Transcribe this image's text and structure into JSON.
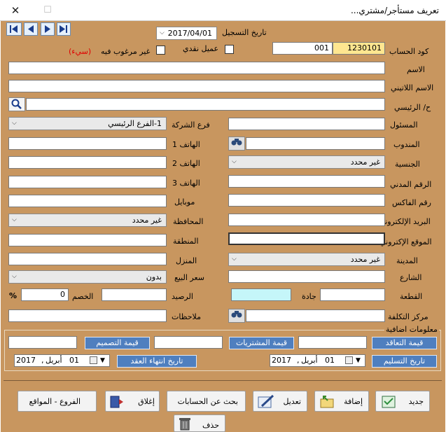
{
  "window": {
    "title": "تعريف مستأجر/مشتري...",
    "close": "✕",
    "maximize": "☐"
  },
  "nav": {
    "first": "first",
    "prev": "previous",
    "next": "next",
    "last": "last"
  },
  "header": {
    "reg_date_label": "تاريخ التسجيل",
    "reg_date_value": "2017/04/01",
    "account_code_label": "كود الحساب",
    "account_code_value": "1230101",
    "account_sub_value": "001",
    "cash_client_label": "عميل نقدي",
    "unwanted_label": "غير مرغوب فيه",
    "unwanted_note": "(سيء)"
  },
  "fields": {
    "name_label": "الاسم",
    "latin_name_label": "الاسم اللاتيني",
    "parent_account_label": "ح/ الرئيسي"
  },
  "right_col": {
    "responsible": "المسئول",
    "representative": "المندوب",
    "nationality": "الجنسية",
    "nationality_value": "غير محدد",
    "civil_no": "الرقم المدني",
    "fax": "رقم الفاكس",
    "email": "البريد الإلكتروني",
    "website": "الموقع الإكتروني",
    "city": "المدينة",
    "city_value": "غير محدد",
    "street": "الشارع",
    "block": "القطعة",
    "avenue": "جادة",
    "cost_center": "مركز التكلفة"
  },
  "left_col": {
    "branch": "فرع الشركة",
    "branch_value": "1-الفرع الرئيسي",
    "phone1": "الهاتف 1",
    "phone2": "الهاتف 2",
    "phone3": "الهاتف 3",
    "mobile": "موبايل",
    "governorate": "المحافظة",
    "governorate_value": "غير محدد",
    "region": "المنطقة",
    "home": "المنزل",
    "sale_price": "سعر البيع",
    "sale_price_value": "بدون",
    "balance": "الرصيد",
    "discount": "الخصم",
    "discount_value": "0",
    "percent": "%",
    "notes": "ملاحظات"
  },
  "extra": {
    "section_label": "معلومات اضافية",
    "contract_value": "قيمة التعاقد",
    "purchases_value": "قيمة المشتريات",
    "design_value": "قيمة التصميم",
    "delivery_date": "تاريخ التسليم",
    "contract_end_date": "تاريخ انتهاء العقد",
    "date1": {
      "day": "01",
      "month": "أبريل",
      "year": "2017"
    },
    "date2": {
      "day": "01",
      "month": "أبريل",
      "year": "2017"
    }
  },
  "actions": {
    "new": "جديد",
    "add": "إضافة",
    "edit": "تعديل",
    "search": "بحث عن الحسابات",
    "close": "إغلاق",
    "branches": "الفروع - المواقع",
    "delete": "حذف"
  }
}
